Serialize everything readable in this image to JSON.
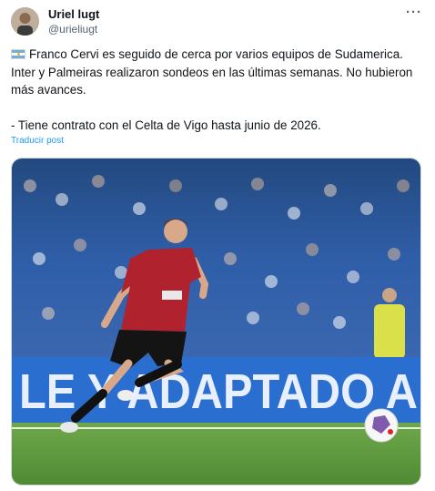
{
  "author": {
    "display_name": "Uriel lugt",
    "handle": "@urieliugt"
  },
  "icons": {
    "more": "more-horizontal-icon",
    "flag": "argentina-flag-icon"
  },
  "tweet": {
    "line1": "Franco Cervi es seguido de cerca por varios equipos de Sudamerica. Inter y Palmeiras realizaron sondeos en las últimas semanas. No hubieron más avances.",
    "line2": "- Tiene contrato con el Celta de Vigo hasta junio de 2026.",
    "translate_label": "Traducir post"
  },
  "media": {
    "banner_text": "LE Y ADAPTADO A",
    "colors": {
      "stands": "#2f5ea8",
      "banner": "#2a6fd0",
      "pitch": "#5f9a3e",
      "shirt": "#b0222e"
    }
  }
}
